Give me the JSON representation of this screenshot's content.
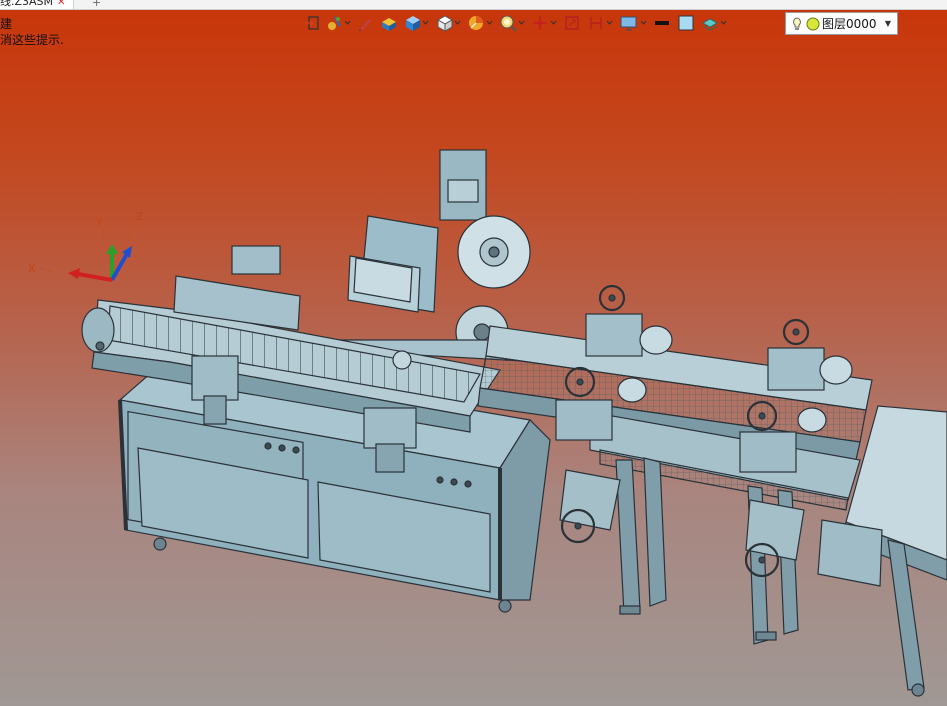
{
  "tab": {
    "title": "线.Z3ASM",
    "add": "+"
  },
  "hints": {
    "line1": "建",
    "line2": "消这些提示."
  },
  "toolbar": {
    "icons": [
      "exit-icon",
      "sketch-icon",
      "pencil-icon",
      "paint-bucket-icon",
      "cube-icon",
      "box-icon",
      "pie-icon",
      "zoom-icon",
      "axis-icon",
      "frame-icon",
      "ruler-icon",
      "monitor-icon",
      "line-color-icon",
      "fill-color-icon",
      "layer-stack-icon"
    ]
  },
  "layer": {
    "label": "图层0000"
  },
  "triad": {
    "x": "X",
    "y": "Y",
    "z": "Z"
  },
  "colors": {
    "machine": "#8fb0bd",
    "outline": "#2a3238",
    "bg_top": "#c9350a",
    "bg_bottom": "#a09894"
  }
}
